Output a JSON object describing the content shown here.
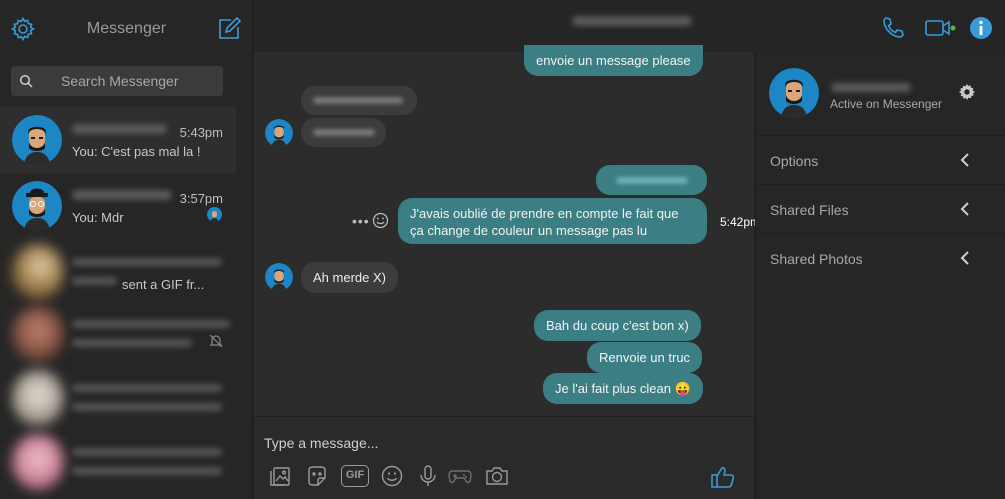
{
  "sidebar": {
    "title": "Messenger",
    "search_placeholder": "Search Messenger",
    "conversations": [
      {
        "time": "5:43pm",
        "preview": "You: C'est pas mal la !"
      },
      {
        "time": "3:57pm",
        "preview": "You: Mdr"
      },
      {
        "preview": "sent a GIF fr..."
      }
    ]
  },
  "chat": {
    "messages": [
      {
        "text": "envoie un message please"
      },
      {
        "line1": "J'avais oublié de prendre en compte le fait que",
        "line2": "ça change de couleur un message pas lu",
        "time": "5:42pm"
      },
      {
        "text": "Ah merde X)"
      },
      {
        "text": "Bah du coup c'est bon x)"
      },
      {
        "text": "Renvoie un truc"
      },
      {
        "text": "Je l'ai fait plus clean",
        "emoji": "😛"
      }
    ],
    "composer_placeholder": "Type a message...",
    "gif_label": "GIF"
  },
  "right_panel": {
    "status": "Active on Messenger",
    "items": [
      {
        "label": "Options"
      },
      {
        "label": "Shared Files"
      },
      {
        "label": "Shared Photos"
      }
    ]
  },
  "colors": {
    "accent": "#3a9bd9",
    "outgoing_bubble": "#3b7f84",
    "incoming_bubble": "#3c3c3c",
    "online_dot": "#3cc14a"
  }
}
